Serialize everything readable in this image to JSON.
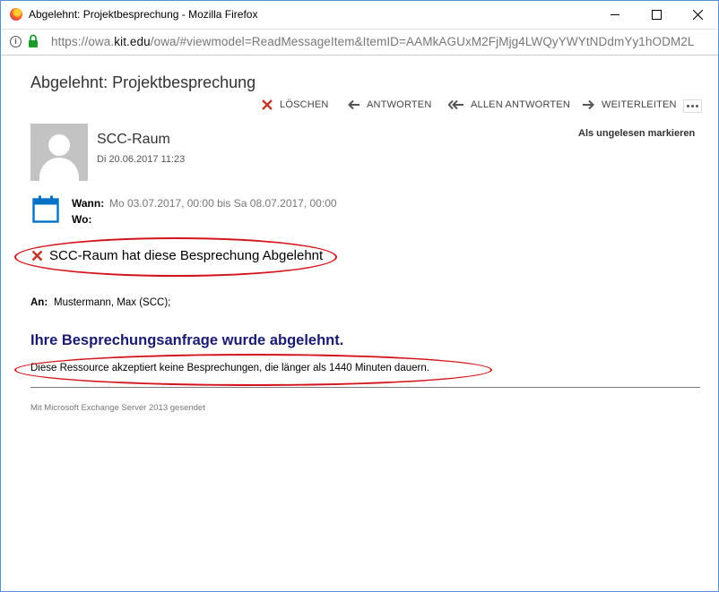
{
  "window": {
    "title": "Abgelehnt: Projektbesprechung - Mozilla Firefox",
    "browser_icon": "firefox-icon"
  },
  "urlbar": {
    "url_prefix": "https://owa.",
    "url_domain": "kit.edu",
    "url_rest": "/owa/#viewmodel=ReadMessageItem&ItemID=AAMkAGUxM2FjMjg4LWQyYWYtNDdmYy1hODM2L"
  },
  "message": {
    "subject": "Abgelehnt: Projektbesprechung",
    "actions": {
      "delete": "LÖSCHEN",
      "reply": "ANTWORTEN",
      "reply_all": "ALLEN ANTWORTEN",
      "forward": "WEITERLEITEN"
    },
    "mark_unread": "Als ungelesen markieren",
    "sender": "SCC-Raum",
    "sent_date": "Di 20.06.2017 11:23",
    "when_label": "Wann:",
    "when_value": "Mo 03.07.2017, 00:00 bis Sa 08.07.2017, 00:00",
    "where_label": "Wo:",
    "status_text": "SCC-Raum hat diese Besprechung Abgelehnt",
    "to_label": "An:",
    "to_value": "Mustermann, Max (SCC);",
    "headline": "Ihre Besprechungsanfrage wurde abgelehnt.",
    "body": "Diese Ressource akzeptiert keine Besprechungen, die länger als 1440 Minuten dauern.",
    "footer": "Mit Microsoft Exchange Server 2013 gesendet"
  },
  "colors": {
    "accent_blue": "#0072c6",
    "decline_red": "#c0392b",
    "annotation_red": "#d4141b",
    "headline_navy": "#1a1a6e"
  }
}
